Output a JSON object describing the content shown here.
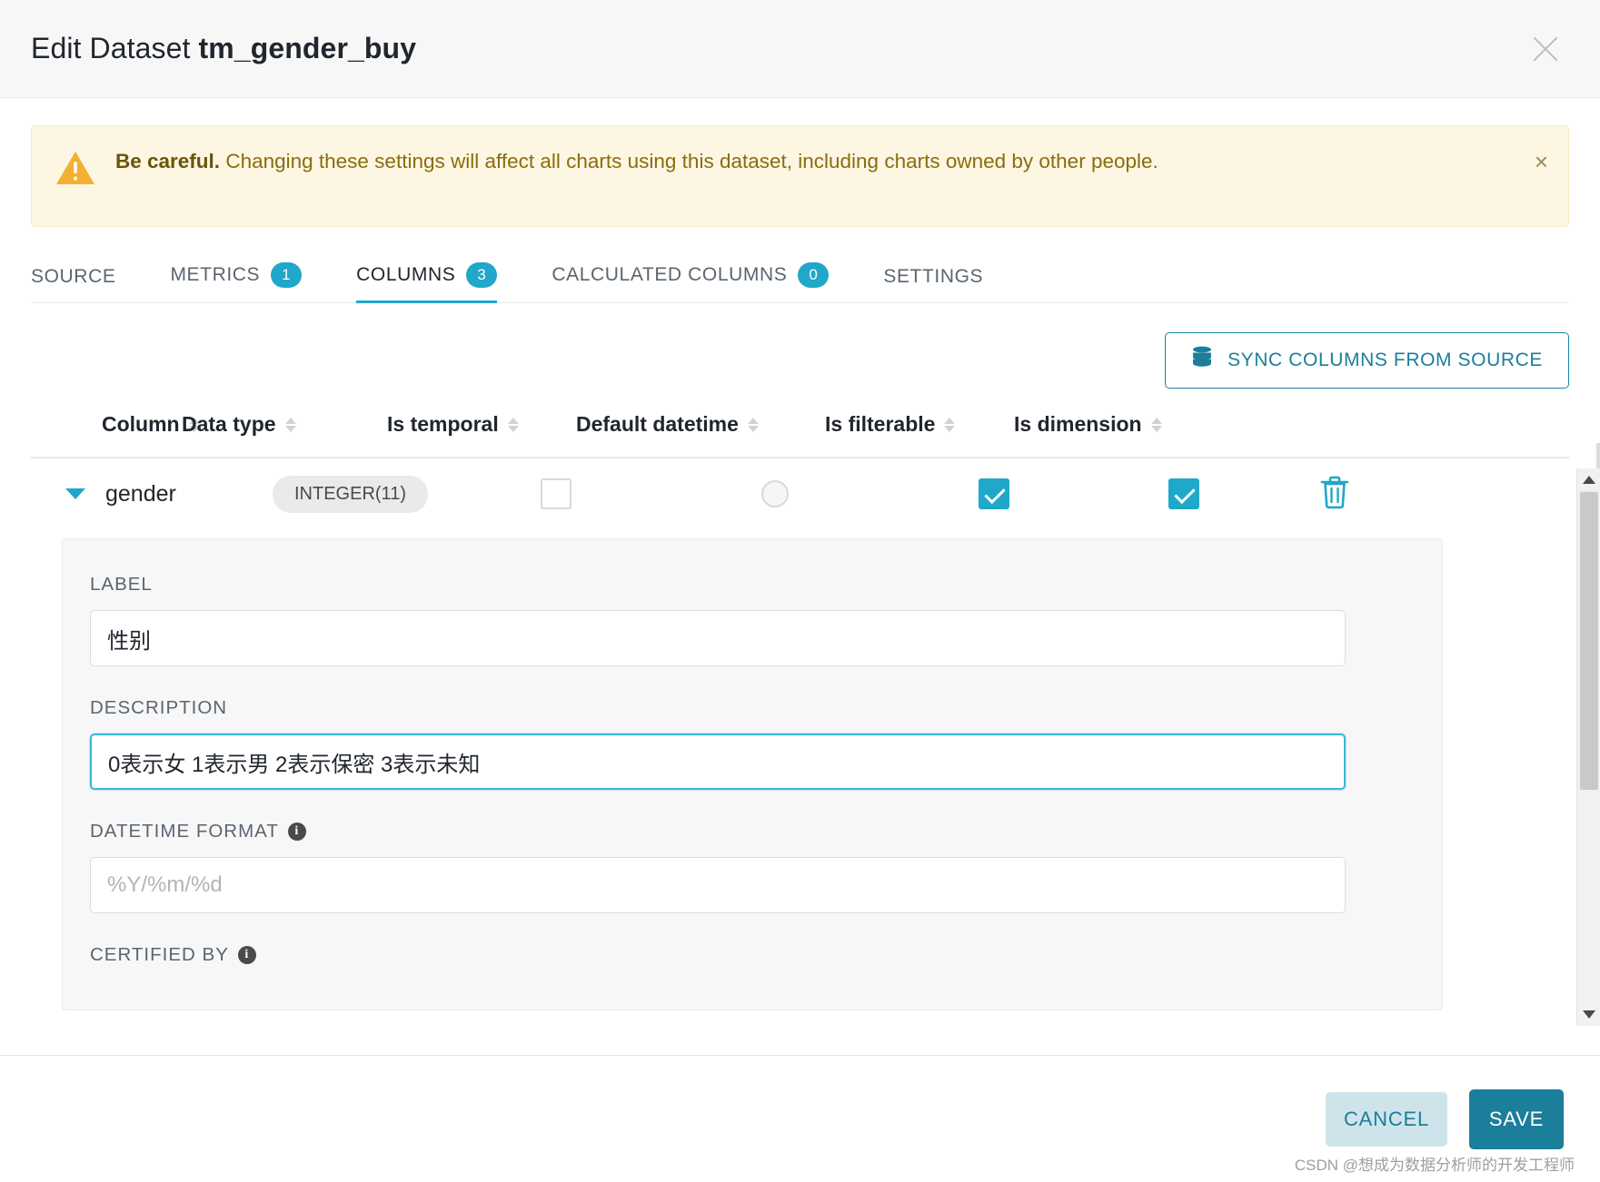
{
  "header": {
    "title_prefix": "Edit Dataset ",
    "dataset_name": "tm_gender_buy",
    "close_icon": "close-icon"
  },
  "alert": {
    "bold": "Be careful.",
    "message": " Changing these settings will affect all charts using this dataset, including charts owned by other people.",
    "close_label": "×",
    "icon": "warning-triangle-icon",
    "bg_color": "#fdf6e3",
    "text_color": "#8a6d0b",
    "icon_color": "#f4b030"
  },
  "tabs": [
    {
      "label": "SOURCE",
      "badge": null,
      "active": false
    },
    {
      "label": "METRICS",
      "badge": "1",
      "active": false
    },
    {
      "label": "COLUMNS",
      "badge": "3",
      "active": true
    },
    {
      "label": "CALCULATED COLUMNS",
      "badge": "0",
      "active": false
    },
    {
      "label": "SETTINGS",
      "badge": null,
      "active": false
    }
  ],
  "toolbar": {
    "sync_label": "SYNC COLUMNS FROM SOURCE",
    "sync_icon": "database-icon"
  },
  "table": {
    "headers": [
      {
        "label": "Column"
      },
      {
        "label": "Data type"
      },
      {
        "label": "Is temporal"
      },
      {
        "label": "Default datetime"
      },
      {
        "label": "Is filterable"
      },
      {
        "label": "Is dimension"
      }
    ],
    "row": {
      "name": "gender",
      "data_type": "INTEGER(11)",
      "is_temporal": false,
      "default_datetime": false,
      "is_filterable": true,
      "is_dimension": true,
      "expanded": true,
      "delete_icon": "trash-icon"
    }
  },
  "panel": {
    "label_field": {
      "label": "LABEL",
      "value": "性别"
    },
    "description_field": {
      "label": "DESCRIPTION",
      "value": "0表示女 1表示男 2表示保密 3表示未知",
      "focused": true
    },
    "datetime_format_field": {
      "label": "DATETIME FORMAT",
      "value": "",
      "placeholder": "%Y/%m/%d",
      "info_icon": "info-icon"
    },
    "certified_by_field": {
      "label": "CERTIFIED BY",
      "info_icon": "info-icon"
    }
  },
  "footer": {
    "cancel_label": "CANCEL",
    "save_label": "SAVE"
  },
  "watermark": "CSDN @想成为数据分析师的开发工程师",
  "colors": {
    "accent": "#20a7c9",
    "primary": "#1b7e9b",
    "warning": "#f4b030"
  }
}
